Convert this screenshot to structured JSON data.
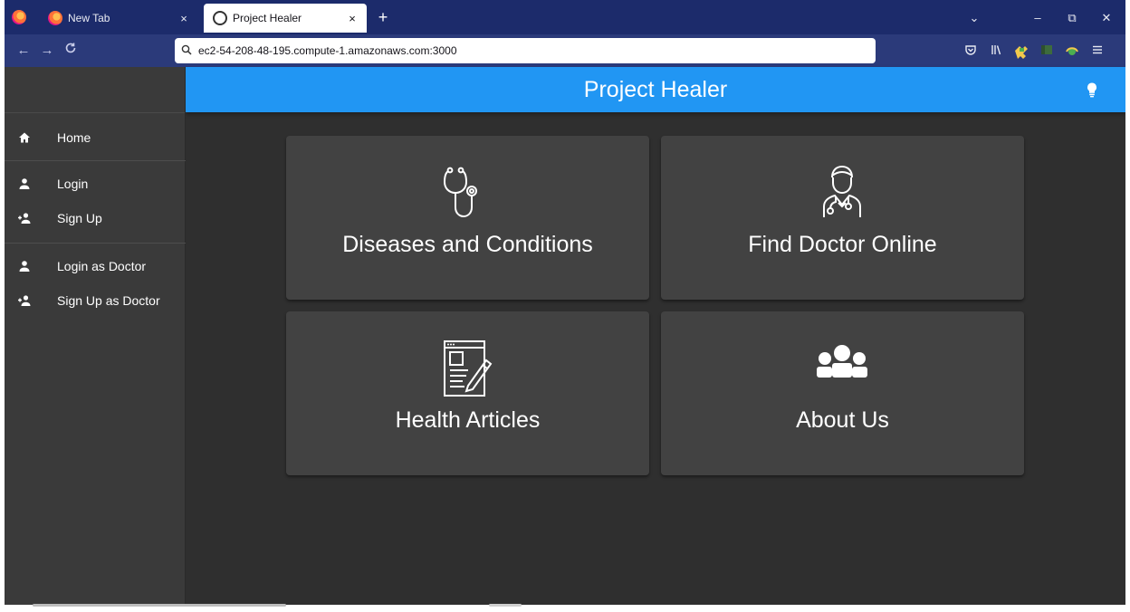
{
  "browser": {
    "tabs": [
      {
        "title": "New Tab",
        "active": false
      },
      {
        "title": "Project Healer",
        "active": true
      }
    ],
    "new_tab_glyph": "+",
    "close_glyph": "×",
    "url": "ec2-54-208-48-195.compute-1.amazonaws.com:3000",
    "window_controls": [
      "⌄",
      "–",
      "⧉",
      "✕"
    ],
    "nav_glyphs": {
      "back": "←",
      "forward": "→",
      "reload": "C"
    },
    "toolbar_icons": [
      "pocket-icon",
      "library-icon",
      "extension-icon",
      "sidebar-icon",
      "addon-icon",
      "menu-icon"
    ],
    "colors": {
      "tabstrip": "#1c2b6b",
      "navbar": "#2b3a7a"
    }
  },
  "app": {
    "title": "Project Healer",
    "theme_icon": "lightbulb-icon",
    "colors": {
      "header": "#2196f3",
      "background": "#2f2f2f",
      "sidebar": "#3a3a3a",
      "card": "#424242"
    }
  },
  "sidebar": {
    "items": [
      {
        "label": "Home",
        "icon": "home-icon"
      },
      {
        "label": "Login",
        "icon": "person-icon"
      },
      {
        "label": "Sign Up",
        "icon": "person-add-icon"
      },
      {
        "label": "Login as Doctor",
        "icon": "person-icon"
      },
      {
        "label": "Sign Up as Doctor",
        "icon": "person-add-icon"
      }
    ]
  },
  "cards": [
    {
      "label": "Diseases and Conditions",
      "icon": "stethoscope-icon"
    },
    {
      "label": "Find Doctor Online",
      "icon": "doctor-icon"
    },
    {
      "label": "Health Articles",
      "icon": "article-icon"
    },
    {
      "label": "About Us",
      "icon": "group-icon"
    }
  ]
}
